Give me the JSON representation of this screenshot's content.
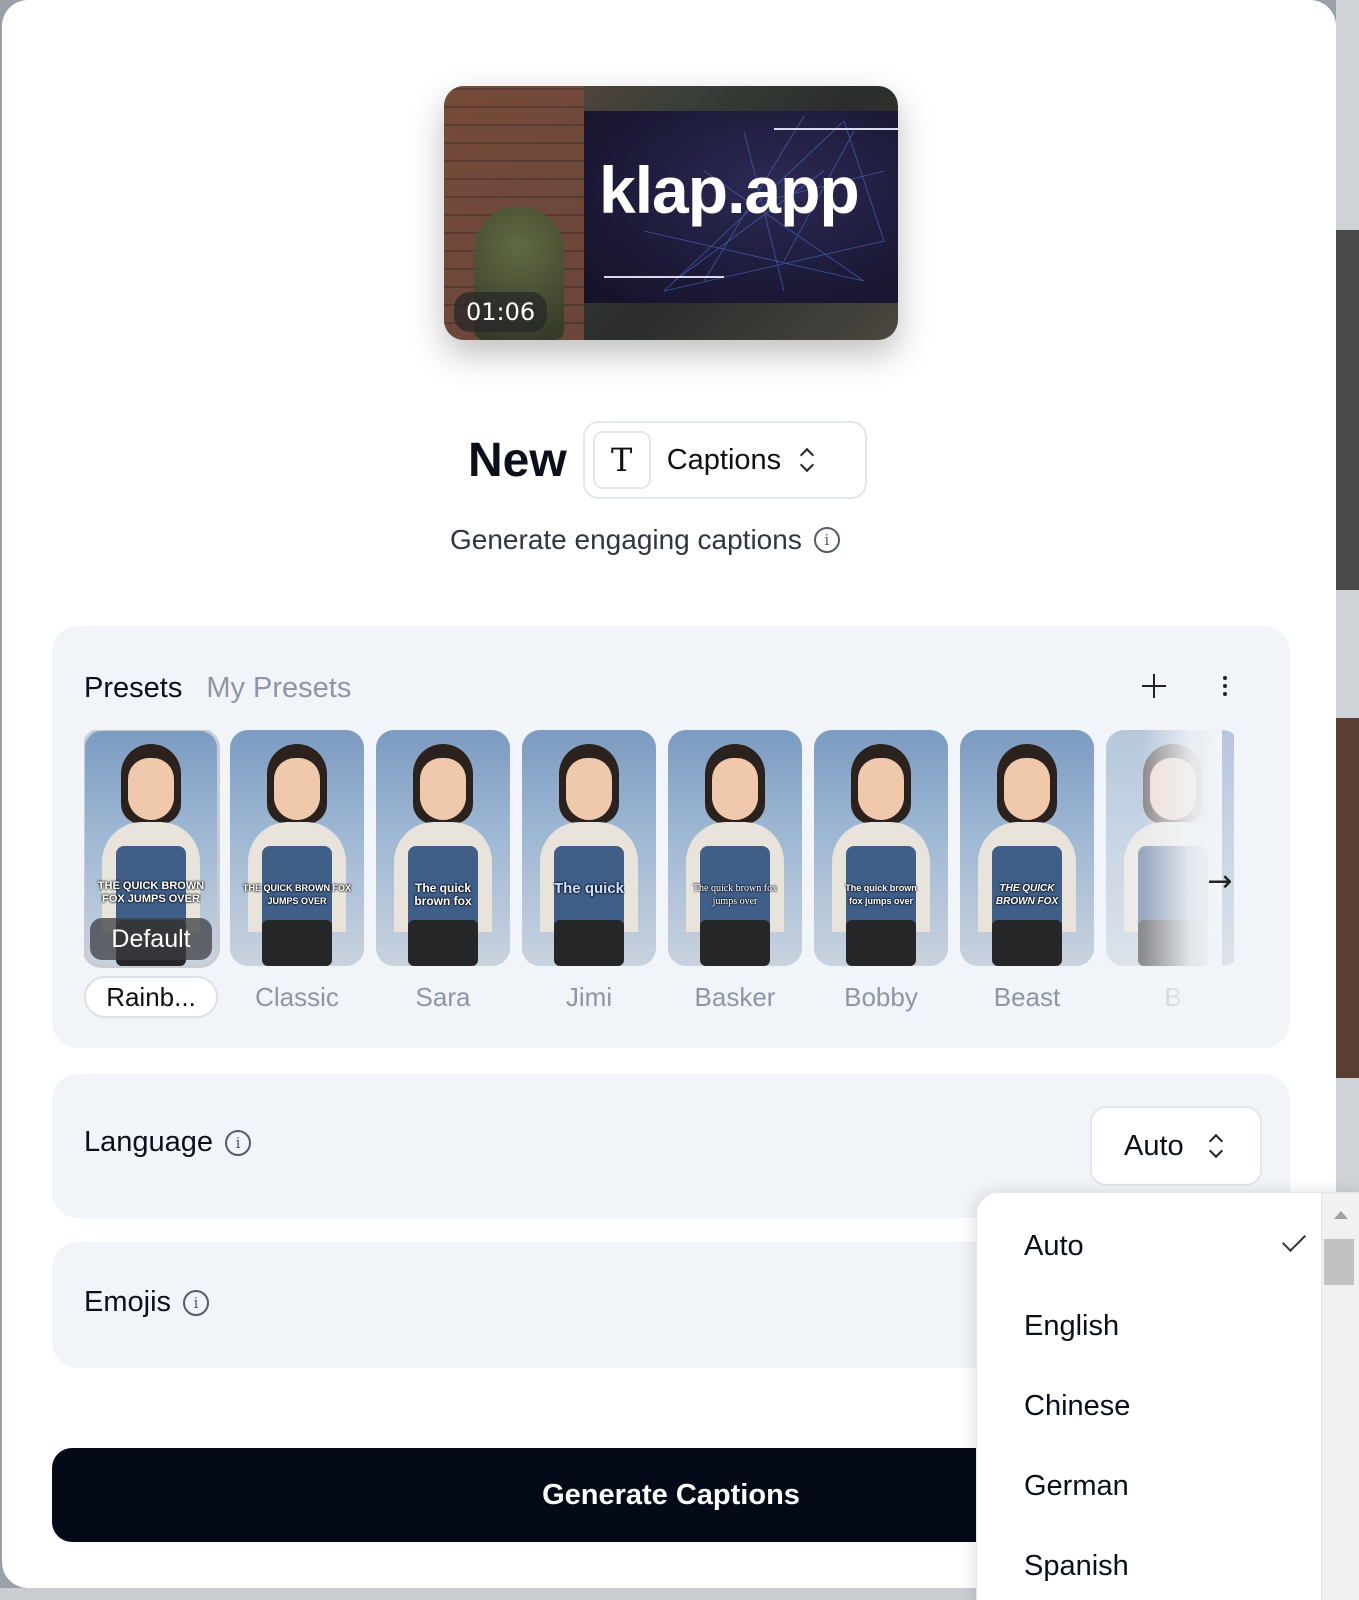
{
  "video": {
    "brand_text": "klap.app",
    "duration": "01:06"
  },
  "header": {
    "title": "New",
    "type_select": {
      "icon": "text-type-icon",
      "label": "Captions"
    },
    "subtitle": "Generate engaging captions"
  },
  "presets": {
    "tabs": [
      {
        "label": "Presets",
        "active": true
      },
      {
        "label": "My Presets",
        "active": false
      }
    ],
    "items": [
      {
        "name": "Rainb...",
        "caption": "THE QUICK BROWN FOX JUMPS OVER",
        "badge": "Default",
        "selected": true
      },
      {
        "name": "Classic",
        "caption": "THE QUICK BROWN FOX JUMPS OVER"
      },
      {
        "name": "Sara",
        "caption": "The quick brown fox"
      },
      {
        "name": "Jimi",
        "caption": "The quick"
      },
      {
        "name": "Basker",
        "caption": "The quick brown fox jumps over"
      },
      {
        "name": "Bobby",
        "caption": "The quick brown fox jumps over"
      },
      {
        "name": "Beast",
        "caption": "THE QUICK BROWN FOX"
      },
      {
        "name": "B",
        "caption": ""
      }
    ]
  },
  "language": {
    "label": "Language",
    "value": "Auto",
    "options": [
      {
        "label": "Auto",
        "selected": true
      },
      {
        "label": "English"
      },
      {
        "label": "Chinese"
      },
      {
        "label": "German"
      },
      {
        "label": "Spanish"
      }
    ]
  },
  "emojis": {
    "label": "Emojis"
  },
  "actions": {
    "generate_label": "Generate Captions"
  },
  "colors": {
    "primary": "#050a19",
    "panel": "#f1f4f8",
    "muted_text": "#8c96a6"
  }
}
